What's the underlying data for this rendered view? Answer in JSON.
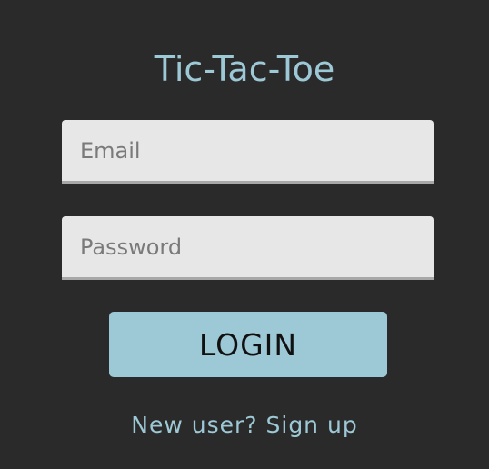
{
  "app": {
    "title": "Tic-Tac-Toe"
  },
  "form": {
    "email": {
      "placeholder": "Email",
      "value": ""
    },
    "password": {
      "placeholder": "Password",
      "value": ""
    },
    "login_label": "LOGIN",
    "signup_label": "New user? Sign up"
  },
  "colors": {
    "background": "#2a2a2a",
    "accent": "#9dc8d6",
    "field_background": "#e7e7e7"
  }
}
